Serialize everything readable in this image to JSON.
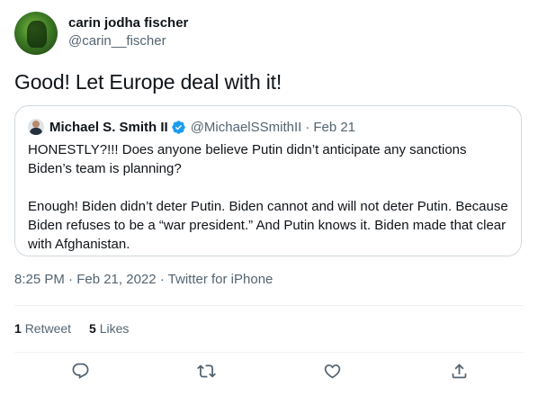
{
  "author": {
    "name": "carin jodha fischer",
    "handle": "@carin__fischer"
  },
  "tweet": {
    "text": "Good! Let Europe deal with it!"
  },
  "quoted": {
    "name": "Michael S. Smith II",
    "handle": "@MichaelSSmithII",
    "separator": "·",
    "date": "Feb 21",
    "verified_color": "#1d9bf0",
    "paragraph1": "HONESTLY?!!! Does anyone believe Putin didn’t anticipate any sanctions Biden’s team is planning?",
    "paragraph2": "Enough! Biden didn’t deter Putin. Biden cannot and will not deter Putin. Because Biden refuses to be a “war president.” And Putin knows it. Biden made that clear with Afghanistan."
  },
  "meta": {
    "text": "8:25 PM · Feb 21, 2022 · Twitter for iPhone"
  },
  "stats": {
    "retweet_count": "1",
    "retweet_label": "Retweet",
    "like_count": "5",
    "like_label": "Likes"
  },
  "actions": {
    "icons": [
      "reply-icon",
      "retweet-icon",
      "like-icon",
      "share-icon"
    ]
  },
  "colors": {
    "text": "#0f1419",
    "secondary": "#536471",
    "border": "#cfd9de"
  }
}
